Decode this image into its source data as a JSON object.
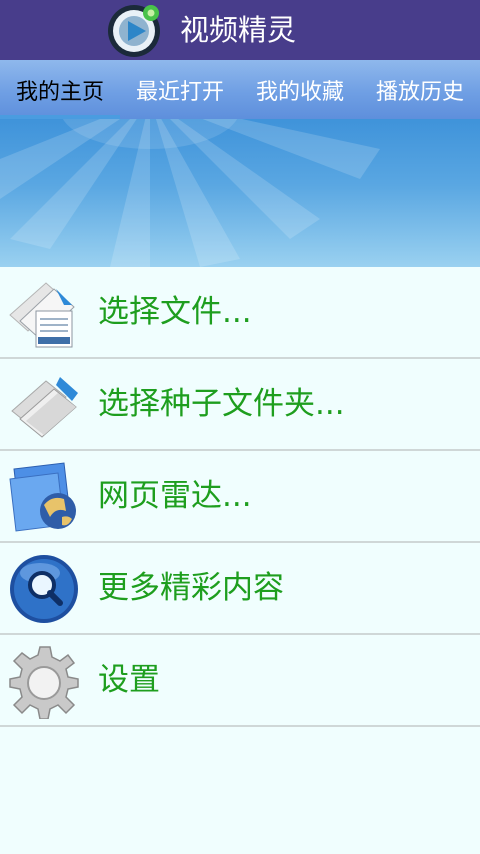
{
  "app": {
    "title": "视频精灵",
    "logo_icon": "play-disc-icon"
  },
  "tabs": [
    {
      "label": "我的主页",
      "active": true
    },
    {
      "label": "最近打开",
      "active": false
    },
    {
      "label": "我的收藏",
      "active": false
    },
    {
      "label": "播放历史",
      "active": false
    }
  ],
  "menu": {
    "items": [
      {
        "label": "选择文件...",
        "icon": "document-icon"
      },
      {
        "label": "选择种子文件夹...",
        "icon": "folder-icon"
      },
      {
        "label": "网页雷达...",
        "icon": "globe-folder-icon"
      },
      {
        "label": "更多精彩内容",
        "icon": "search-globe-icon"
      },
      {
        "label": "设置",
        "icon": "gear-icon"
      }
    ]
  },
  "colors": {
    "titlebar": "#483d8b",
    "tabbar": "#6f9fe4",
    "menu_text": "#1e9e1e",
    "background": "#f0fefe"
  }
}
